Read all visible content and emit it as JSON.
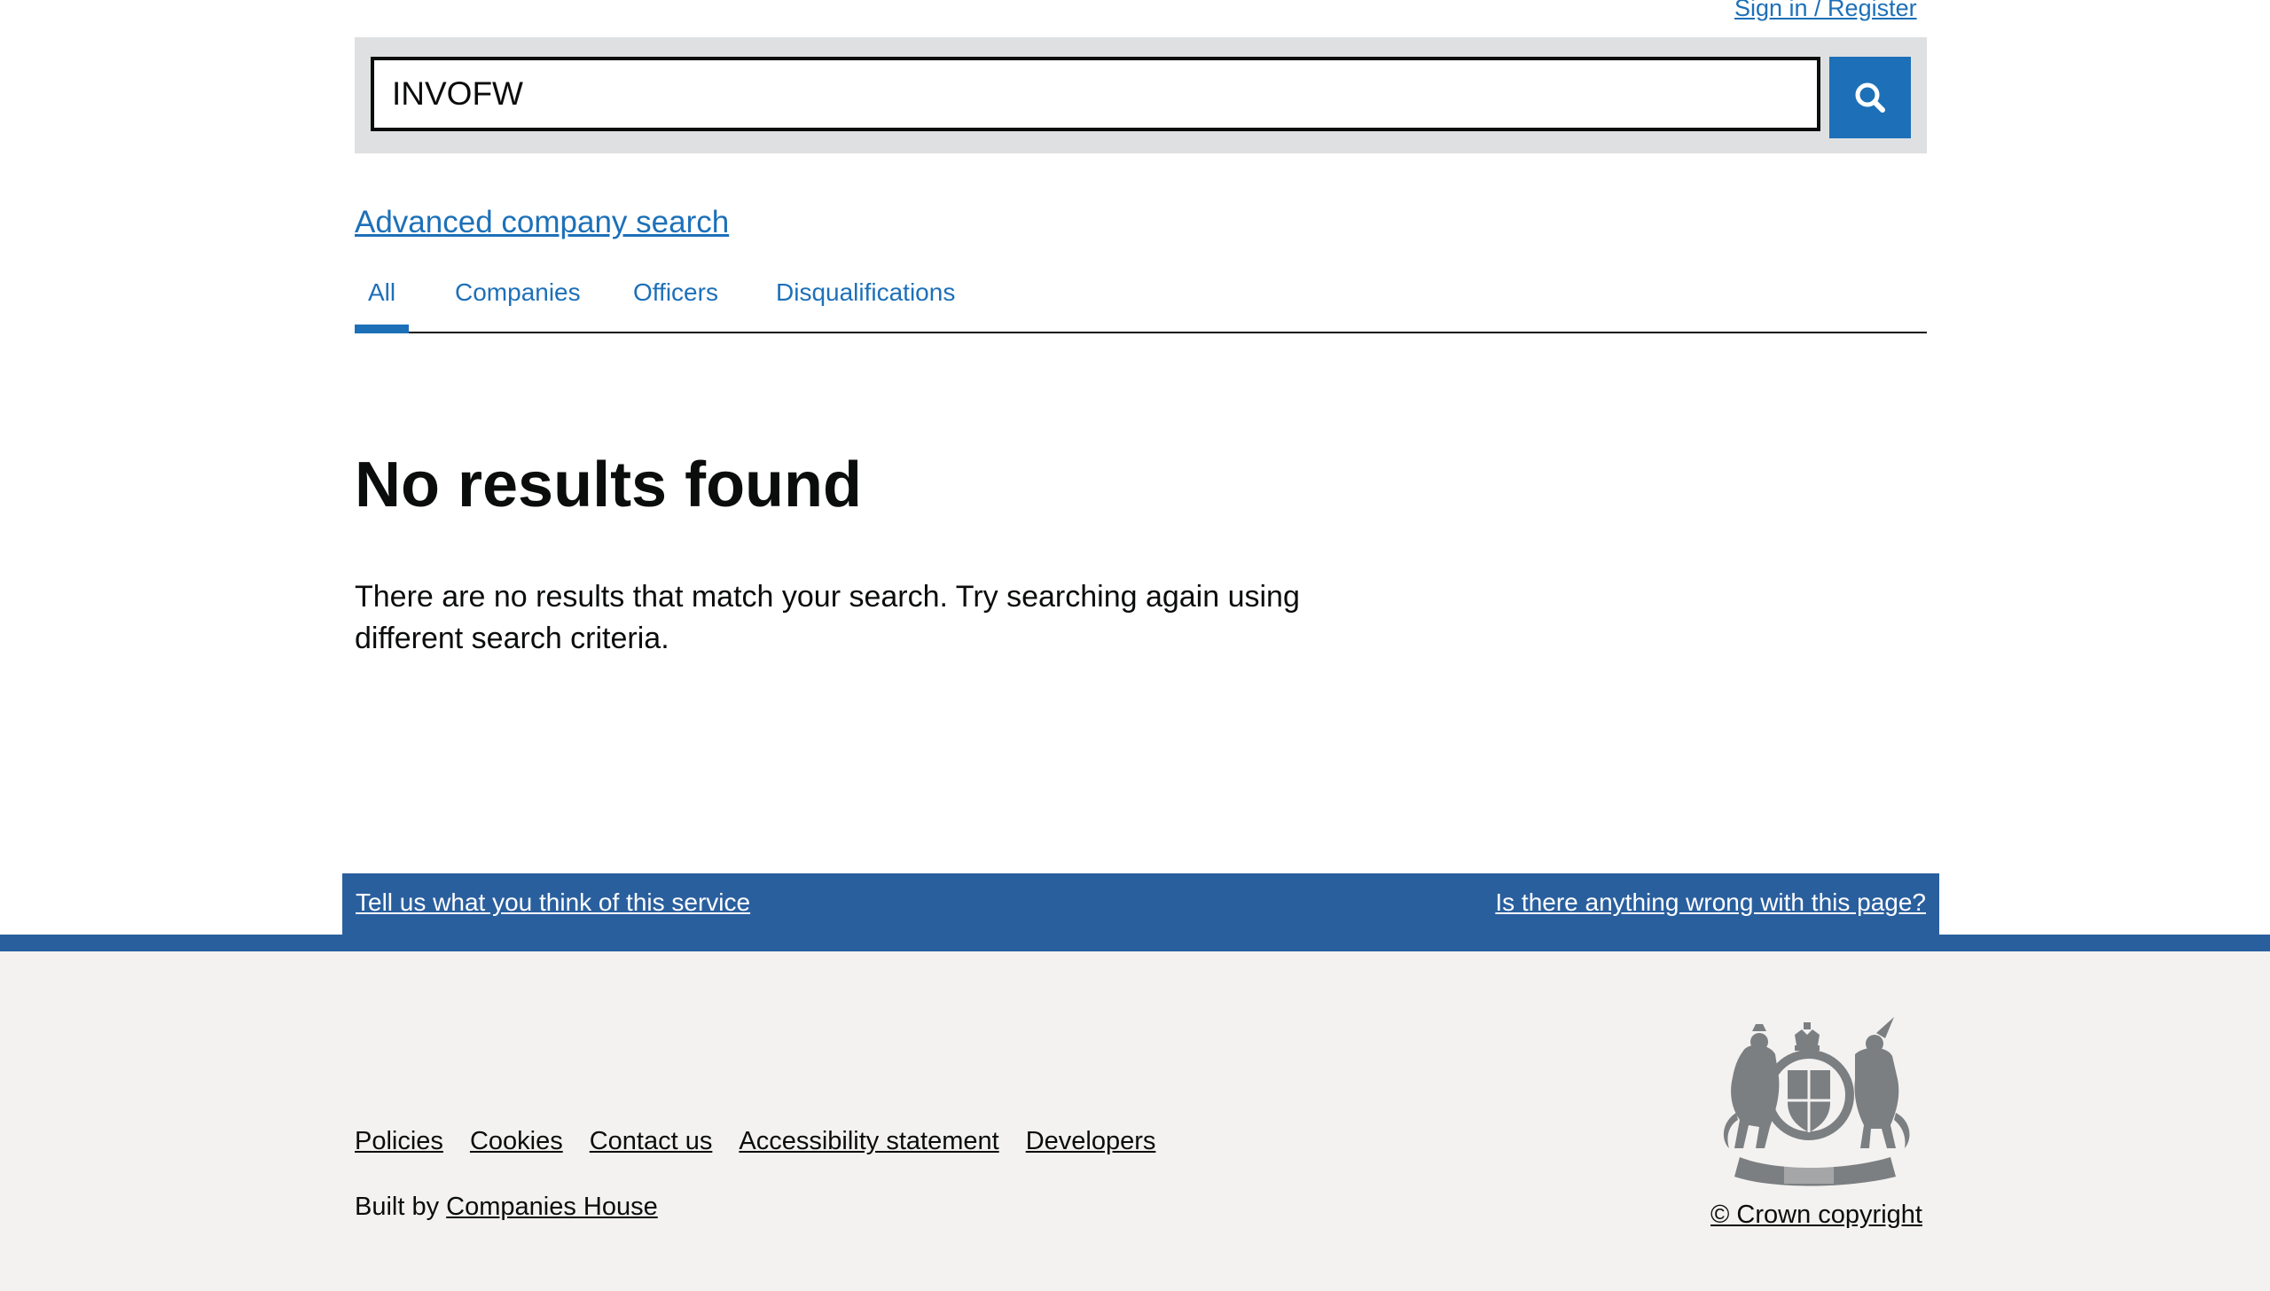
{
  "header": {
    "sign_in_label": "Sign in / Register"
  },
  "search": {
    "value": "INVOFW",
    "button_icon": "search-icon"
  },
  "advanced_search_label": "Advanced company search",
  "tabs": [
    {
      "label": "All",
      "active": true
    },
    {
      "label": "Companies",
      "active": false
    },
    {
      "label": "Officers",
      "active": false
    },
    {
      "label": "Disqualifications",
      "active": false
    }
  ],
  "main": {
    "heading": "No results found",
    "message": "There are no results that match your search. Try searching again using different search criteria."
  },
  "feedback": {
    "left_label": "Tell us what you think of this service",
    "right_label": "Is there anything wrong with this page?"
  },
  "footer": {
    "links": [
      "Policies",
      "Cookies",
      "Contact us",
      "Accessibility statement",
      "Developers"
    ],
    "built_by_prefix": "Built by",
    "built_by_link": "Companies House",
    "crest_icon": "royal-coat-of-arms-icon",
    "copyright_label": "© Crown copyright"
  },
  "colors": {
    "link_blue": "#1d70b8",
    "feedback_bar": "#2a5f9e",
    "search_panel": "#dee0e2",
    "footer_bg": "#f3f2f1",
    "crest_grey": "#7b7f82"
  }
}
